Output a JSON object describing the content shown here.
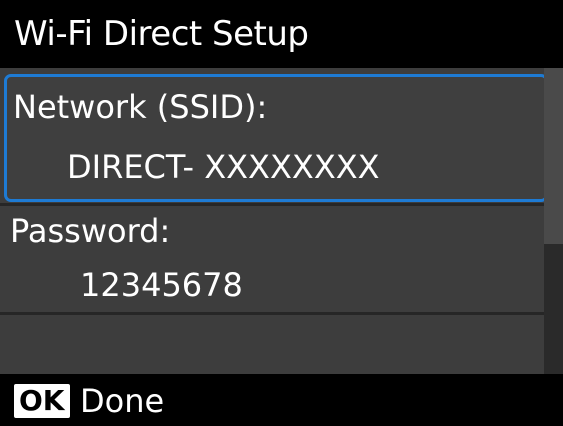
{
  "header": {
    "title": "Wi-Fi Direct Setup"
  },
  "network": {
    "label": "Network (SSID):",
    "value": "DIRECT- XXXXXXXX"
  },
  "password": {
    "label": "Password:",
    "value": "12345678"
  },
  "footer": {
    "key": "OK",
    "label": "Done"
  },
  "colors": {
    "selection": "#1e7bd4",
    "panel": "#3d3d3d",
    "background": "#000000"
  }
}
